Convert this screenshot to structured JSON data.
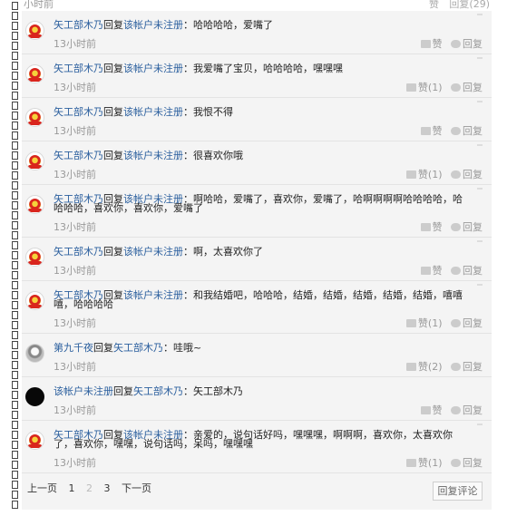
{
  "top": {
    "time": "小时前",
    "like": "赞",
    "reply": "回复(29)"
  },
  "strings": {
    "replied": "回复",
    "sep": "："
  },
  "comments": [
    {
      "author": "矢工部木乃",
      "target": "该帐户未注册",
      "text": "哈哈哈哈，爱嘴了",
      "time": "13小时前",
      "like": "赞",
      "reply": "回复"
    },
    {
      "author": "矢工部木乃",
      "target": "该帐户未注册",
      "text": "我爱嘴了宝贝，哈哈哈哈，嘿嘿嘿",
      "time": "13小时前",
      "like": "赞(1)",
      "reply": "回复"
    },
    {
      "author": "矢工部木乃",
      "target": "该帐户未注册",
      "text": "我恨不得",
      "time": "13小时前",
      "like": "赞",
      "reply": "回复"
    },
    {
      "author": "矢工部木乃",
      "target": "该帐户未注册",
      "text": "很喜欢你哦",
      "time": "13小时前",
      "like": "赞(1)",
      "reply": "回复"
    },
    {
      "author": "矢工部木乃",
      "target": "该帐户未注册",
      "text": "啊哈哈，爱嘴了，喜欢你，爱嘴了，哈啊啊啊啊哈哈哈哈，哈哈哈哈，喜欢你，喜欢你，爱嘴了",
      "time": "13小时前",
      "like": "赞",
      "reply": "回复"
    },
    {
      "author": "矢工部木乃",
      "target": "该帐户未注册",
      "text": "啊，太喜欢你了",
      "time": "13小时前",
      "like": "赞",
      "reply": "回复"
    },
    {
      "author": "矢工部木乃",
      "target": "该帐户未注册",
      "text": "和我结婚吧，哈哈哈，结婚，结婚，结婚，结婚，结婚，嘻嘻嘻，哈哈哈哈",
      "time": "13小时前",
      "like": "赞(1)",
      "reply": "回复"
    },
    {
      "author": "第九千夜",
      "target": "矢工部木乃",
      "text": "哇哦~",
      "time": "13小时前",
      "like": "赞(2)",
      "reply": "回复"
    },
    {
      "author": "该帐户未注册",
      "target": "矢工部木乃",
      "text": "矢工部木乃",
      "time": "13小时前",
      "like": "赞",
      "reply": "回复"
    },
    {
      "author": "矢工部木乃",
      "target": "该帐户未注册",
      "text": "亲爱的，说句话好吗，嘿嘿嘿，啊啊啊，喜欢你，太喜欢你了，喜欢你，嘿嘿，说句话吗，呆吗，嘿嘿嘿",
      "time": "13小时前",
      "like": "赞(1)",
      "reply": "回复"
    }
  ],
  "pagination": {
    "prev": "上一页",
    "pages": [
      "1",
      "2",
      "3"
    ],
    "current": "2",
    "next": "下一页"
  },
  "reply_comment_button": "回复评论"
}
